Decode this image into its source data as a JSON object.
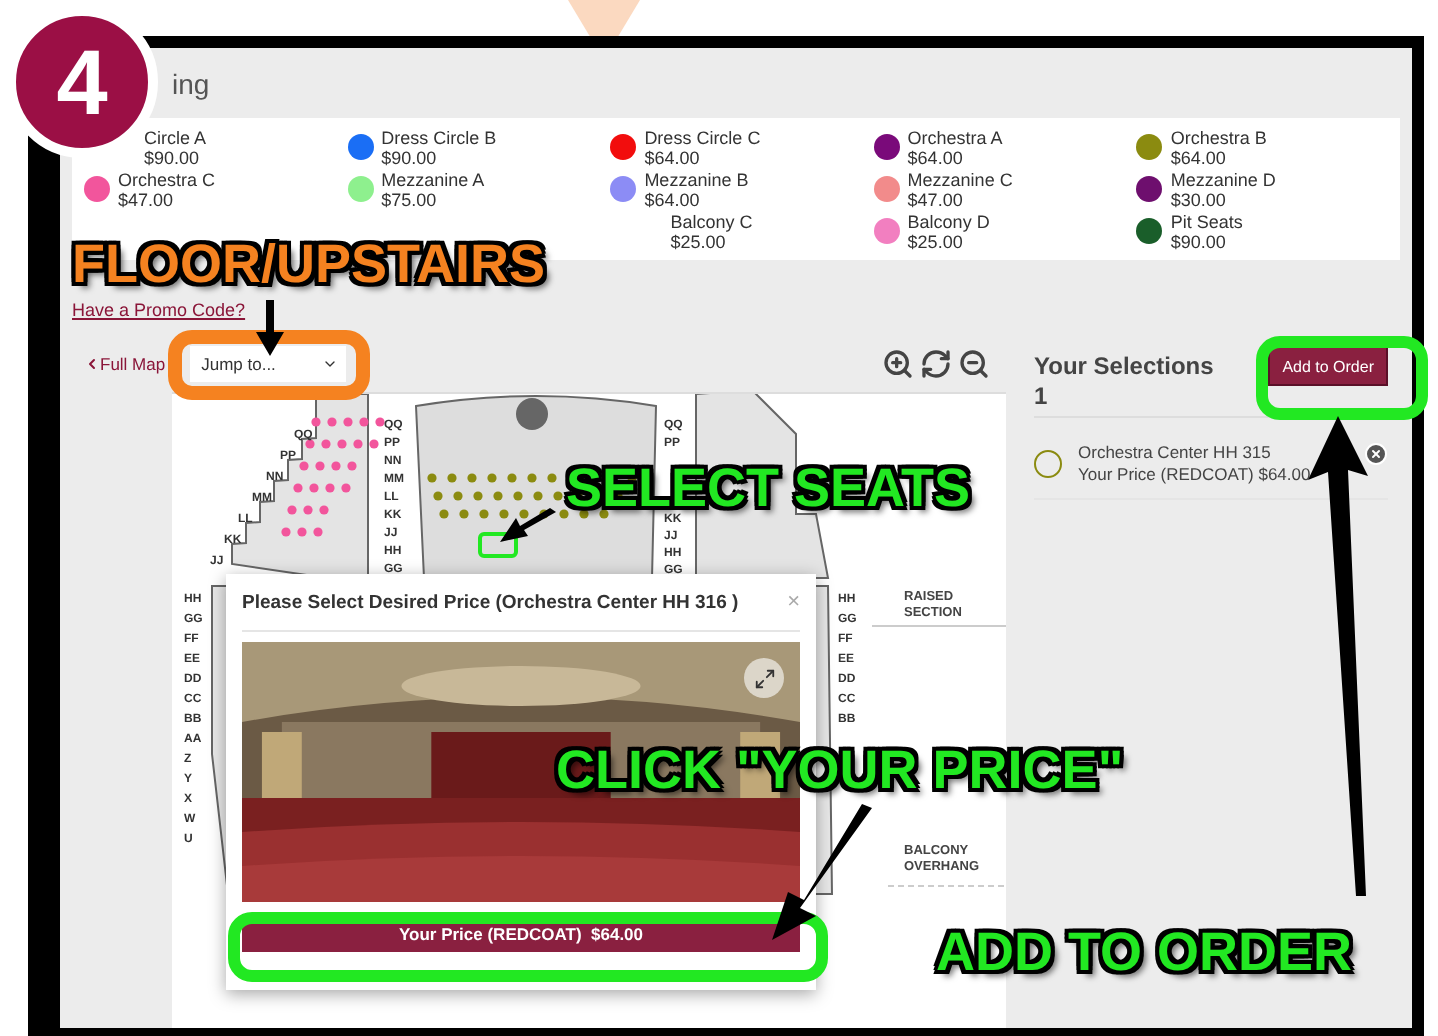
{
  "step_badge": "4",
  "page_title": "ing",
  "price_legend": {
    "rows": [
      [
        {
          "name": "Circle A",
          "price": "$90.00"
        },
        {
          "name": "Dress Circle B",
          "price": "$90.00",
          "color": "#1a6ef5"
        },
        {
          "name": "Dress Circle C",
          "price": "$64.00",
          "color": "#f20d0d"
        },
        {
          "name": "Orchestra A",
          "price": "$64.00",
          "color": "#7a0a7a"
        },
        {
          "name": "Orchestra B",
          "price": "$64.00",
          "color": "#8b8b10"
        }
      ],
      [
        {
          "name": "Orchestra C",
          "price": "$47.00",
          "color": "#f2559c"
        },
        {
          "name": "Mezzanine A",
          "price": "$75.00",
          "color": "#8ef08e"
        },
        {
          "name": "Mezzanine B",
          "price": "$64.00",
          "color": "#8c8cf5"
        },
        {
          "name": "Mezzanine C",
          "price": "$47.00",
          "color": "#f28b8b"
        },
        {
          "name": "Mezzanine D",
          "price": "$30.00",
          "color": "#6e0f6e"
        }
      ],
      [
        "",
        "",
        {
          "name": "Balcony C",
          "price": "$25.00"
        },
        {
          "name": "Balcony D",
          "price": "$25.00",
          "color": "#f27fc0"
        },
        {
          "name": "Pit Seats",
          "price": "$90.00",
          "color": "#1a5e2a"
        }
      ]
    ]
  },
  "promo_link": "Have a Promo Code?",
  "map_toolbar": {
    "back_link": "Full Map",
    "jump_select": {
      "value": "Jump to..."
    }
  },
  "seat_map": {
    "center_rows": [
      "QQ",
      "PP",
      "NN",
      "MM",
      "LL",
      "KK",
      "JJ",
      "HH",
      "GG"
    ],
    "left_upper_rows": [
      "QQ",
      "PP",
      "NN",
      "MM",
      "LL",
      "KK",
      "JJ"
    ],
    "left_lower_rows": [
      "HH",
      "GG",
      "FF",
      "EE",
      "DD",
      "CC",
      "BB",
      "AA",
      "Z",
      "Y",
      "X",
      "W",
      "U"
    ],
    "right_upper_rows": [
      "QQ",
      "PP"
    ],
    "right_middle_rows": [
      "KK",
      "JJ",
      "HH",
      "GG"
    ],
    "right_lower_rows": [
      "HH",
      "GG",
      "FF",
      "EE",
      "DD",
      "CC",
      "BB"
    ],
    "notes": [
      "RAISED SECTION",
      "BALCONY OVERHANG"
    ]
  },
  "price_dialog": {
    "title": "Please Select Desired Price (Orchestra Center HH 316 )",
    "close": "×",
    "price_button": "Your Price (REDCOAT)  $64.00"
  },
  "selections": {
    "heading": "Your Selections",
    "count": "1",
    "add_button": "Add to Order",
    "items": [
      {
        "seat": "Orchestra Center HH 315",
        "price": "Your Price (REDCOAT) $64.00"
      }
    ]
  },
  "annotations": [
    {
      "text": "FLOOR/UPSTAIRS",
      "color": "#f58220"
    },
    {
      "text": "SELECT SEATS",
      "color": "#22e822"
    },
    {
      "text": "CLICK \"YOUR PRICE\"",
      "color": "#22e822"
    },
    {
      "text": "ADD TO ORDER",
      "color": "#22e822"
    }
  ]
}
